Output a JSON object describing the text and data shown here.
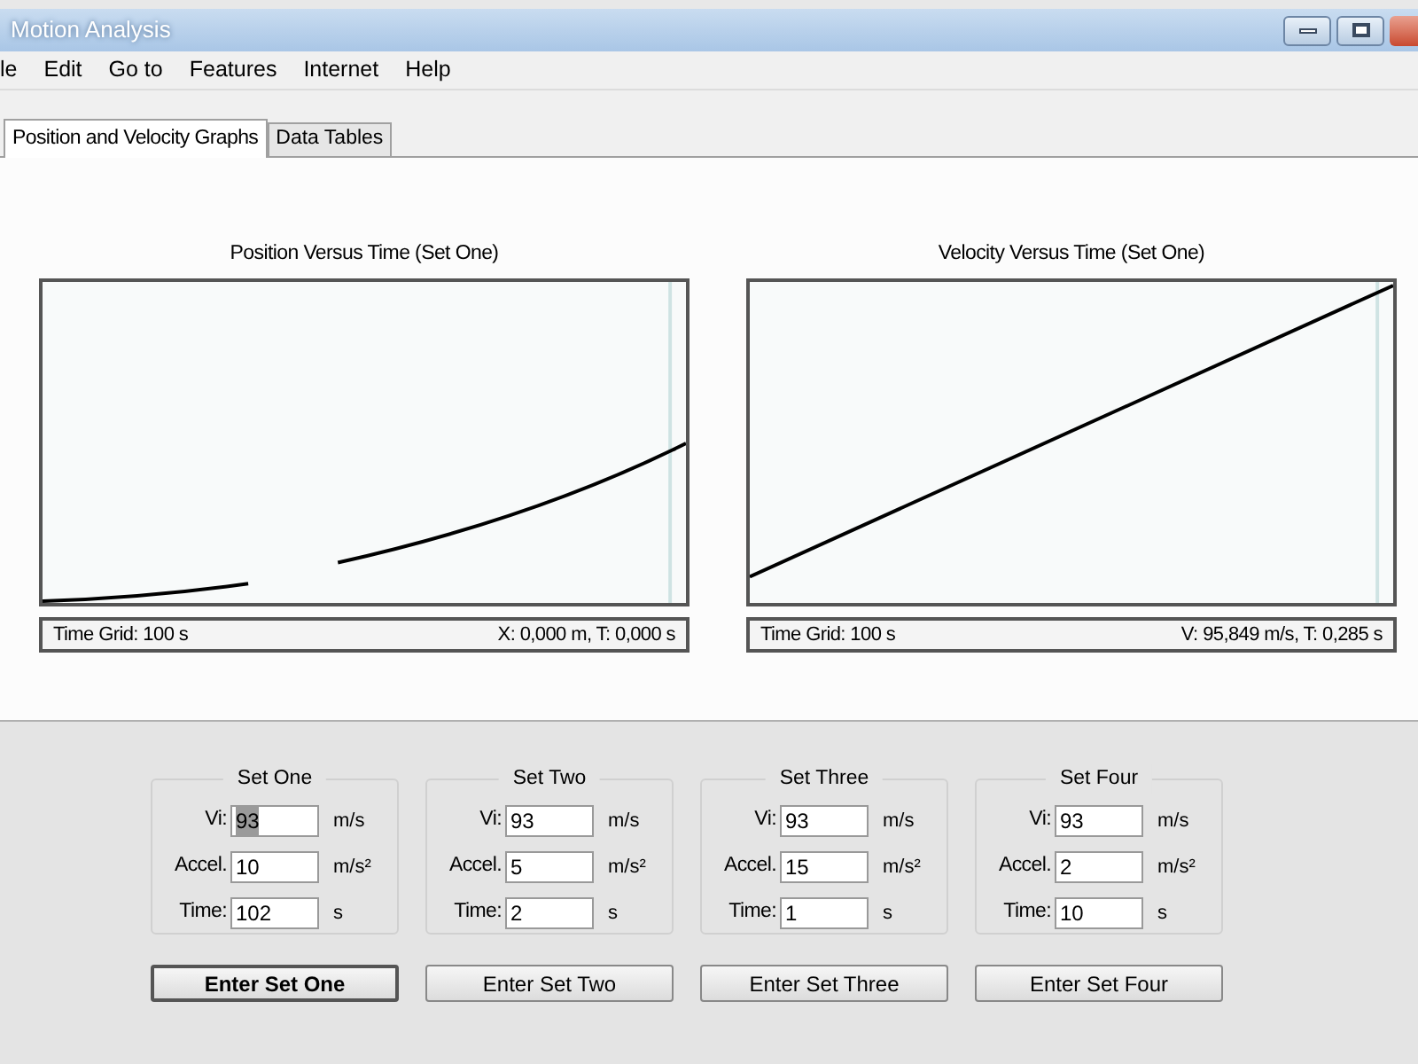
{
  "window": {
    "title": "Motion Analysis"
  },
  "menu": [
    "le",
    "Edit",
    "Go to",
    "Features",
    "Internet",
    "Help"
  ],
  "tabs": [
    {
      "label": "Position and Velocity Graphs",
      "selected": true
    },
    {
      "label": "Data Tables",
      "selected": false
    }
  ],
  "graphs": [
    {
      "kind": "position",
      "title": "Position Versus Time (Set One)",
      "grid": "Time Grid: 100 s",
      "reading": "X: 0,000 m, T: 0,000 s"
    },
    {
      "kind": "velocity",
      "title": "Velocity Versus Time (Set One)",
      "grid": "Time Grid: 100 s",
      "reading": "V: 95,849 m/s, T: 0,285 s"
    }
  ],
  "sets": [
    {
      "title": "Set One",
      "fields": [
        {
          "label": "Vi:",
          "value": "93",
          "unit": "m/s",
          "selected": true
        },
        {
          "label": "Accel.",
          "value": "10",
          "unit": "m/s²",
          "selected": false
        },
        {
          "label": "Time:",
          "value": "102",
          "unit": "s",
          "selected": false
        }
      ],
      "button": "Enter Set One",
      "default": true
    },
    {
      "title": "Set Two",
      "fields": [
        {
          "label": "Vi:",
          "value": "93",
          "unit": "m/s",
          "selected": false
        },
        {
          "label": "Accel.",
          "value": "5",
          "unit": "m/s²",
          "selected": false
        },
        {
          "label": "Time:",
          "value": "2",
          "unit": "s",
          "selected": false
        }
      ],
      "button": "Enter Set Two",
      "default": false
    },
    {
      "title": "Set Three",
      "fields": [
        {
          "label": "Vi:",
          "value": "93",
          "unit": "m/s",
          "selected": false
        },
        {
          "label": "Accel.",
          "value": "15",
          "unit": "m/s²",
          "selected": false
        },
        {
          "label": "Time:",
          "value": "1",
          "unit": "s",
          "selected": false
        }
      ],
      "button": "Enter Set Three",
      "default": false
    },
    {
      "title": "Set Four",
      "fields": [
        {
          "label": "Vi:",
          "value": "93",
          "unit": "m/s",
          "selected": false
        },
        {
          "label": "Accel.",
          "value": "2",
          "unit": "m/s²",
          "selected": false
        },
        {
          "label": "Time:",
          "value": "10",
          "unit": "s",
          "selected": false
        }
      ],
      "button": "Enter Set Four",
      "default": false
    }
  ]
}
